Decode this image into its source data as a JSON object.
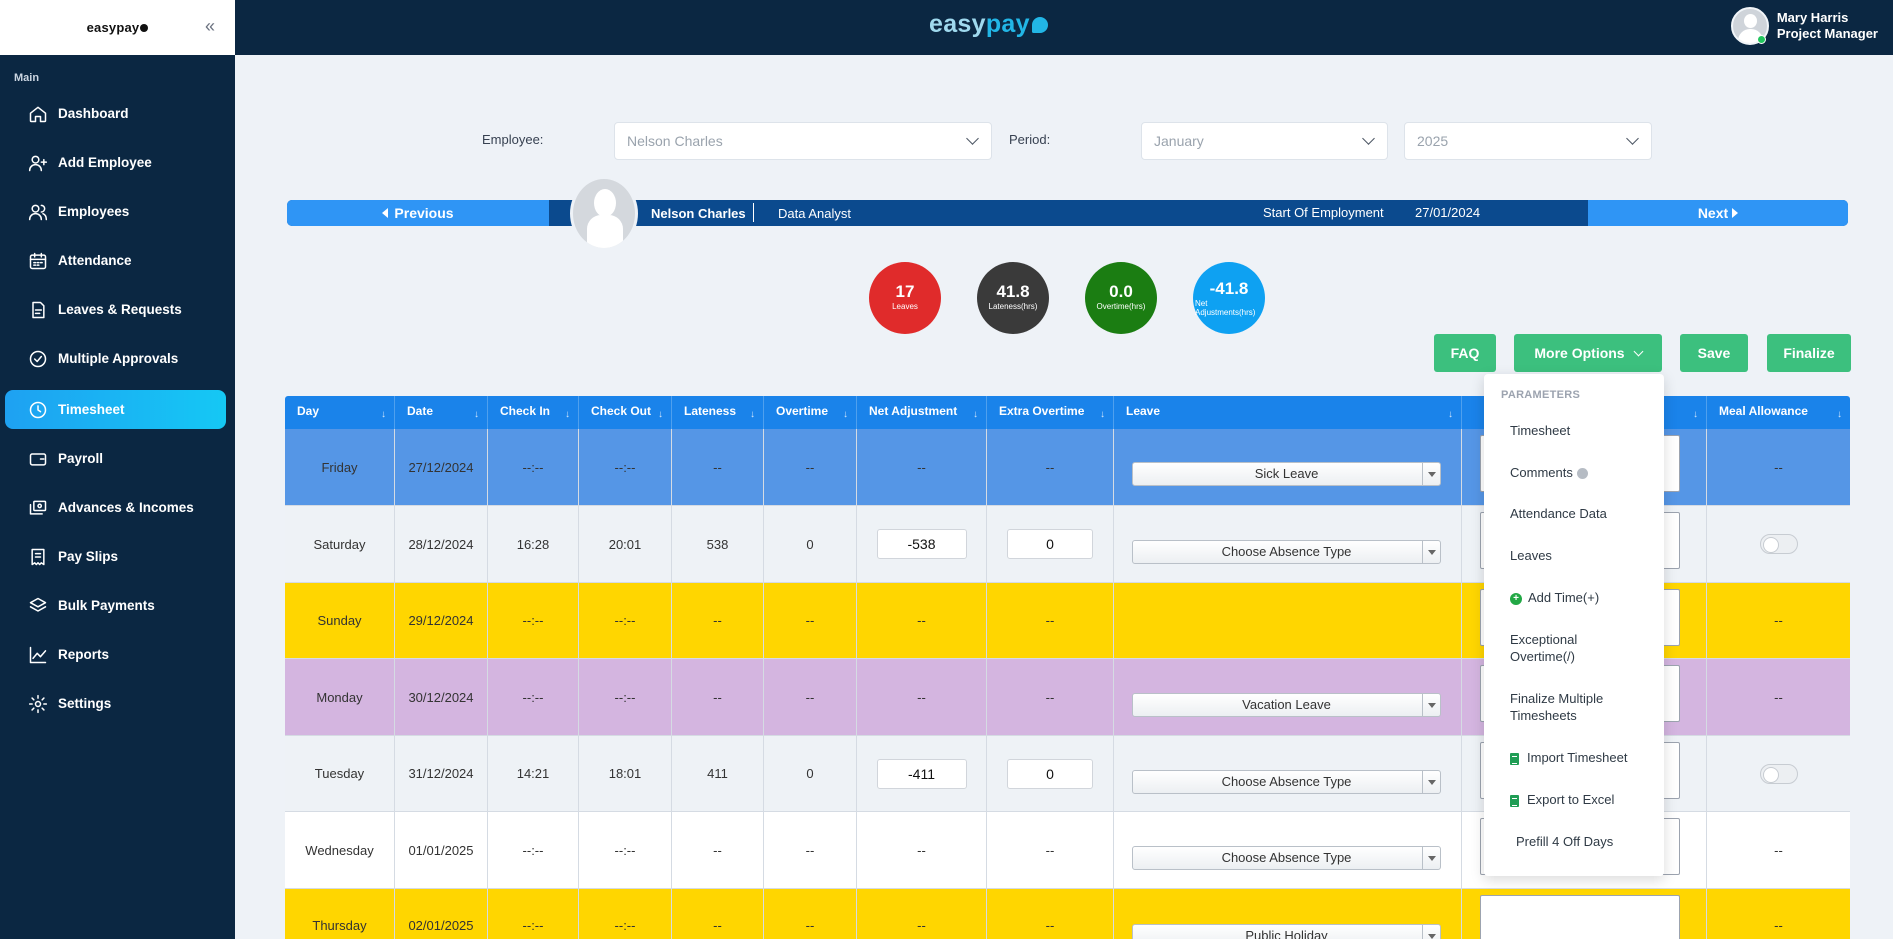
{
  "brand": {
    "sidebar_logo": "easypay",
    "header_easy": "easy",
    "header_pay": "pay"
  },
  "user": {
    "name": "Mary Harris",
    "role": "Project Manager"
  },
  "sidebar": {
    "section": "Main",
    "items": [
      {
        "label": "Dashboard",
        "icon": "home-icon"
      },
      {
        "label": "Add Employee",
        "icon": "user-plus-icon"
      },
      {
        "label": "Employees",
        "icon": "users-icon"
      },
      {
        "label": "Attendance",
        "icon": "calendar-icon"
      },
      {
        "label": "Leaves & Requests",
        "icon": "document-icon"
      },
      {
        "label": "Multiple Approvals",
        "icon": "check-circle-icon"
      },
      {
        "label": "Timesheet",
        "icon": "clock-icon",
        "active": true
      },
      {
        "label": "Payroll",
        "icon": "wallet-icon"
      },
      {
        "label": "Advances & Incomes",
        "icon": "cards-icon"
      },
      {
        "label": "Pay Slips",
        "icon": "payslip-icon"
      },
      {
        "label": "Bulk Payments",
        "icon": "layers-icon"
      },
      {
        "label": "Reports",
        "icon": "chart-icon"
      },
      {
        "label": "Settings",
        "icon": "gear-icon"
      }
    ]
  },
  "filters": {
    "employee_label": "Employee:",
    "employee_value": "Nelson Charles",
    "period_label": "Period:",
    "month_value": "January",
    "year_value": "2025"
  },
  "employee_bar": {
    "previous": "Previous",
    "next": "Next",
    "name": "Nelson Charles",
    "position": "Data Analyst",
    "start_label": "Start Of Employment",
    "start_date": "27/01/2024"
  },
  "stats": [
    {
      "value": "17",
      "label": "Leaves",
      "color": "#e02b2b"
    },
    {
      "value": "41.8",
      "label": "Lateness(hrs)",
      "color": "#3a3a3a"
    },
    {
      "value": "0.0",
      "label": "Overtime(hrs)",
      "color": "#1b7d12"
    },
    {
      "value": "-41.8",
      "label": "Net Adjustments(hrs)",
      "color": "#0ea1f2"
    }
  ],
  "buttons": {
    "faq": "FAQ",
    "more_options": "More Options",
    "save": "Save",
    "finalize": "Finalize"
  },
  "table": {
    "headers": [
      "Day",
      "Date",
      "Check In",
      "Check Out",
      "Lateness",
      "Overtime",
      "Net Adjustment",
      "Extra Overtime",
      "Leave",
      "",
      "Meal Allowance"
    ],
    "rows": [
      {
        "day": "Friday",
        "date": "27/12/2024",
        "check_in": "--:--",
        "check_out": "--:--",
        "lateness": "--",
        "overtime": "--",
        "net_adjustment": "--",
        "extra_overtime": "--",
        "leave": "Sick Leave",
        "meal": "--",
        "bg": "#5596e6"
      },
      {
        "day": "Saturday",
        "date": "28/12/2024",
        "check_in": "16:28",
        "check_out": "20:01",
        "lateness": "538",
        "overtime": "0",
        "net_adjustment": "-538",
        "extra_overtime": "0",
        "leave": "Choose Absence Type",
        "meal": "",
        "bg": "#eef2f6"
      },
      {
        "day": "Sunday",
        "date": "29/12/2024",
        "check_in": "--:--",
        "check_out": "--:--",
        "lateness": "--",
        "overtime": "--",
        "net_adjustment": "--",
        "extra_overtime": "--",
        "leave": "",
        "meal": "--",
        "bg": "#ffd600"
      },
      {
        "day": "Monday",
        "date": "30/12/2024",
        "check_in": "--:--",
        "check_out": "--:--",
        "lateness": "--",
        "overtime": "--",
        "net_adjustment": "--",
        "extra_overtime": "--",
        "leave": "Vacation Leave",
        "meal": "--",
        "bg": "#d4b5e0"
      },
      {
        "day": "Tuesday",
        "date": "31/12/2024",
        "check_in": "14:21",
        "check_out": "18:01",
        "lateness": "411",
        "overtime": "0",
        "net_adjustment": "-411",
        "extra_overtime": "0",
        "leave": "Choose Absence Type",
        "meal": "",
        "bg": "#eef2f6"
      },
      {
        "day": "Wednesday",
        "date": "01/01/2025",
        "check_in": "--:--",
        "check_out": "--:--",
        "lateness": "--",
        "overtime": "--",
        "net_adjustment": "--",
        "extra_overtime": "--",
        "leave": "Choose Absence Type",
        "meal": "--",
        "bg": "#ffffff"
      },
      {
        "day": "Thursday",
        "date": "02/01/2025",
        "check_in": "--:--",
        "check_out": "--:--",
        "lateness": "--",
        "overtime": "--",
        "net_adjustment": "--",
        "extra_overtime": "--",
        "leave": "Public Holiday",
        "meal": "--",
        "bg": "#ffd600"
      }
    ]
  },
  "dropdown": {
    "header": "PARAMETERS",
    "items": [
      "Timesheet",
      "Comments",
      "Attendance Data",
      "Leaves",
      "Add Time(+)",
      "Exceptional Overtime(/)",
      "Finalize Multiple Timesheets",
      "Import Timesheet",
      "Export to Excel",
      "Prefill 4 Off Days"
    ]
  }
}
